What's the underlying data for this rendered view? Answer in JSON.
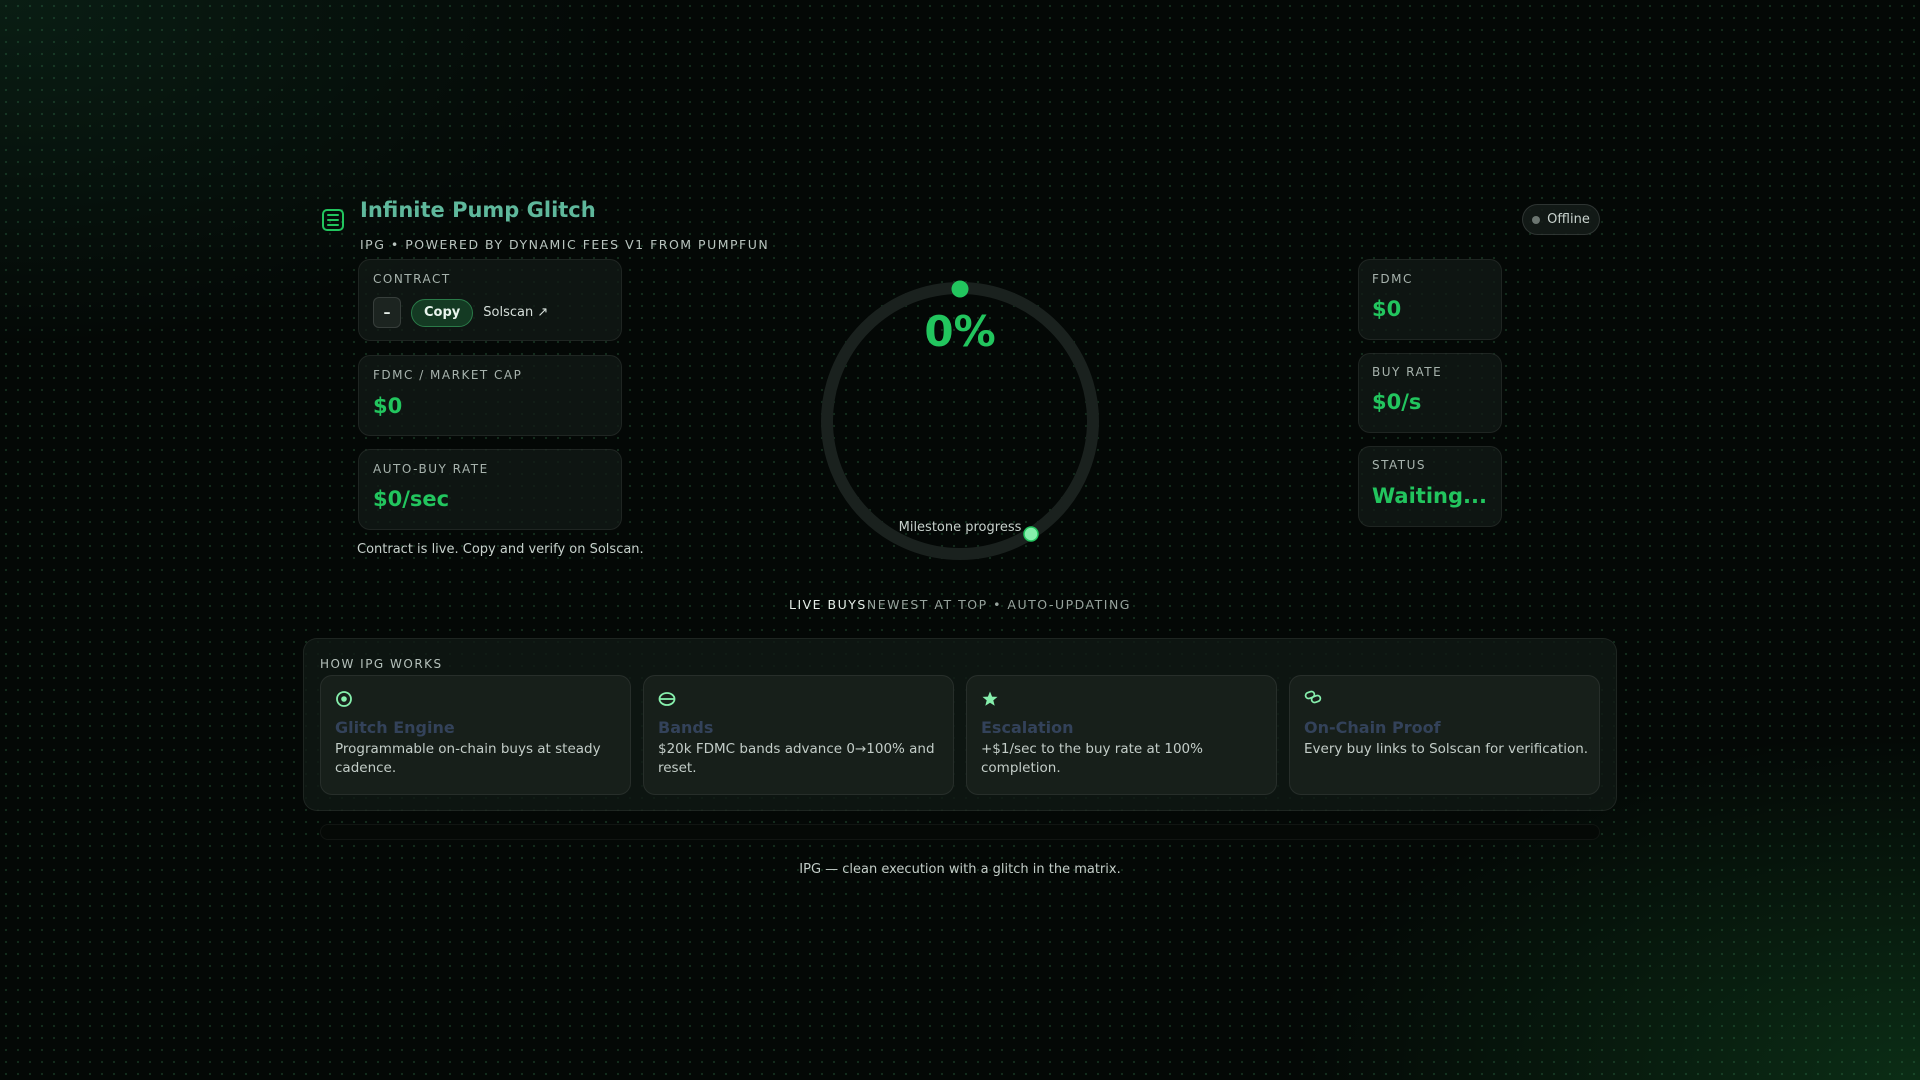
{
  "header": {
    "title": "Infinite Pump Glitch",
    "subtitle": "IPG • POWERED BY DYNAMIC FEES V1 FROM PUMPFUN",
    "connection_status": "Offline"
  },
  "left_panel": {
    "contract": {
      "label": "CONTRACT",
      "value": "–",
      "copy_label": "Copy",
      "solscan_label": "Solscan ↗"
    },
    "fdmc_market_cap": {
      "label": "FDMC / MARKET CAP",
      "value": "$0"
    },
    "auto_buy_rate": {
      "label": "AUTO-BUY RATE",
      "value": "$0/sec"
    },
    "note": "Contract is live. Copy and verify on Solscan."
  },
  "progress": {
    "percent_text": "0%",
    "percent_value": 0,
    "label": "Milestone progress"
  },
  "right_panel": {
    "fdmc": {
      "label": "FDMC",
      "value": "$0"
    },
    "buy_rate": {
      "label": "BUY RATE",
      "value": "$0/s"
    },
    "status": {
      "label": "STATUS",
      "value": "Waiting..."
    }
  },
  "live_buys": {
    "title": "LIVE BUYS",
    "subtitle": "NEWEST AT TOP • AUTO-UPDATING"
  },
  "how_it_works": {
    "heading": "HOW IPG WORKS",
    "cards": [
      {
        "icon": "target-icon",
        "title": "Glitch Engine",
        "body": "Programmable on-chain buys at steady cadence."
      },
      {
        "icon": "bands-icon",
        "title": "Bands",
        "body": "$20k FDMC bands advance 0→100% and reset."
      },
      {
        "icon": "star-icon",
        "title": "Escalation",
        "body": "+$1/sec to the buy rate at 100% completion."
      },
      {
        "icon": "chain-link-icon",
        "title": "On-Chain Proof",
        "body": "Every buy links to Solscan for verification."
      }
    ]
  },
  "footer": {
    "tagline": "IPG — clean execution with a glitch in the matrix."
  },
  "colors": {
    "accent": "#22c55e",
    "title": "#5fb89c",
    "background": "#040806",
    "card_title": "#33425a"
  }
}
